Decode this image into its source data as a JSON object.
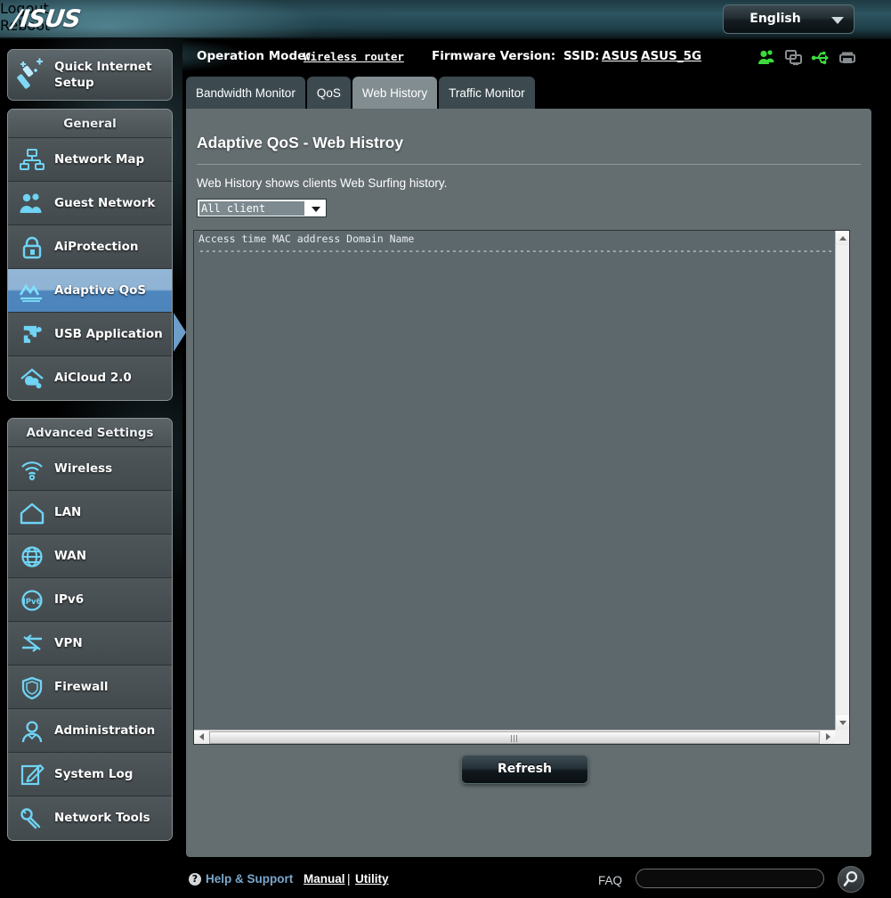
{
  "header": {
    "logo": "/ISUS",
    "logout_label": "Logout",
    "reboot_label": "Reboot",
    "language": "English",
    "operation_mode_label": "Operation Mode:",
    "operation_mode_value": "Wireless router",
    "firmware_label": "Firmware Version:",
    "firmware_value": "",
    "ssid_label": "SSID:",
    "ssid_24g": "ASUS",
    "ssid_5g": "ASUS_5G",
    "status_icons": [
      {
        "name": "clients-icon",
        "color": "#3ddb3d"
      },
      {
        "name": "devices-icon",
        "color": "#878c8f"
      },
      {
        "name": "usb-icon",
        "color": "#3ddb3d"
      },
      {
        "name": "printer-icon",
        "color": "#878c8f"
      }
    ]
  },
  "sidebar": {
    "quick_setup_label": "Quick Internet Setup",
    "general": {
      "title": "General",
      "items": [
        {
          "label": "Network Map",
          "icon": "network-map-icon",
          "active": false
        },
        {
          "label": "Guest Network",
          "icon": "guest-network-icon",
          "active": false
        },
        {
          "label": "AiProtection",
          "icon": "lock-shield-icon",
          "active": false
        },
        {
          "label": "Adaptive QoS",
          "icon": "qos-chart-icon",
          "active": true
        },
        {
          "label": "USB Application",
          "icon": "puzzle-piece-icon",
          "active": false
        },
        {
          "label": "AiCloud 2.0",
          "icon": "cloud-home-icon",
          "active": false
        }
      ]
    },
    "advanced": {
      "title": "Advanced Settings",
      "items": [
        {
          "label": "Wireless",
          "icon": "wifi-icon",
          "active": false
        },
        {
          "label": "LAN",
          "icon": "home-icon",
          "active": false
        },
        {
          "label": "WAN",
          "icon": "globe-icon",
          "active": false
        },
        {
          "label": "IPv6",
          "icon": "ipv6-globe-icon",
          "active": false
        },
        {
          "label": "VPN",
          "icon": "vpn-arrows-icon",
          "active": false
        },
        {
          "label": "Firewall",
          "icon": "shield-icon",
          "active": false
        },
        {
          "label": "Administration",
          "icon": "user-icon",
          "active": false
        },
        {
          "label": "System Log",
          "icon": "pencil-note-icon",
          "active": false
        },
        {
          "label": "Network Tools",
          "icon": "wrench-icon",
          "active": false
        }
      ]
    }
  },
  "tabs": [
    {
      "label": "Bandwidth Monitor",
      "active": false
    },
    {
      "label": "QoS",
      "active": false
    },
    {
      "label": "Web History",
      "active": true
    },
    {
      "label": "Traffic Monitor",
      "active": false
    }
  ],
  "main": {
    "title": "Adaptive QoS - Web Histroy",
    "description": "Web History shows clients Web Surfing history.",
    "client_filter": {
      "selected": "All client",
      "options": [
        "All client"
      ]
    },
    "history": {
      "column_header": "Access time MAC address Domain Name",
      "separator": "--------------------------------------------------------------------------------------------------------------",
      "rows": []
    },
    "refresh_label": "Refresh",
    "scroll": {
      "horizontal_thumb_grip": "|||"
    }
  },
  "footer": {
    "help_icon": "?",
    "help_label": "Help & Support",
    "manual_label": "Manual",
    "separator": "|",
    "utility_label": "Utility",
    "faq_label": "FAQ",
    "faq_value": "",
    "faq_placeholder": "",
    "search_icon": "search-icon"
  }
}
